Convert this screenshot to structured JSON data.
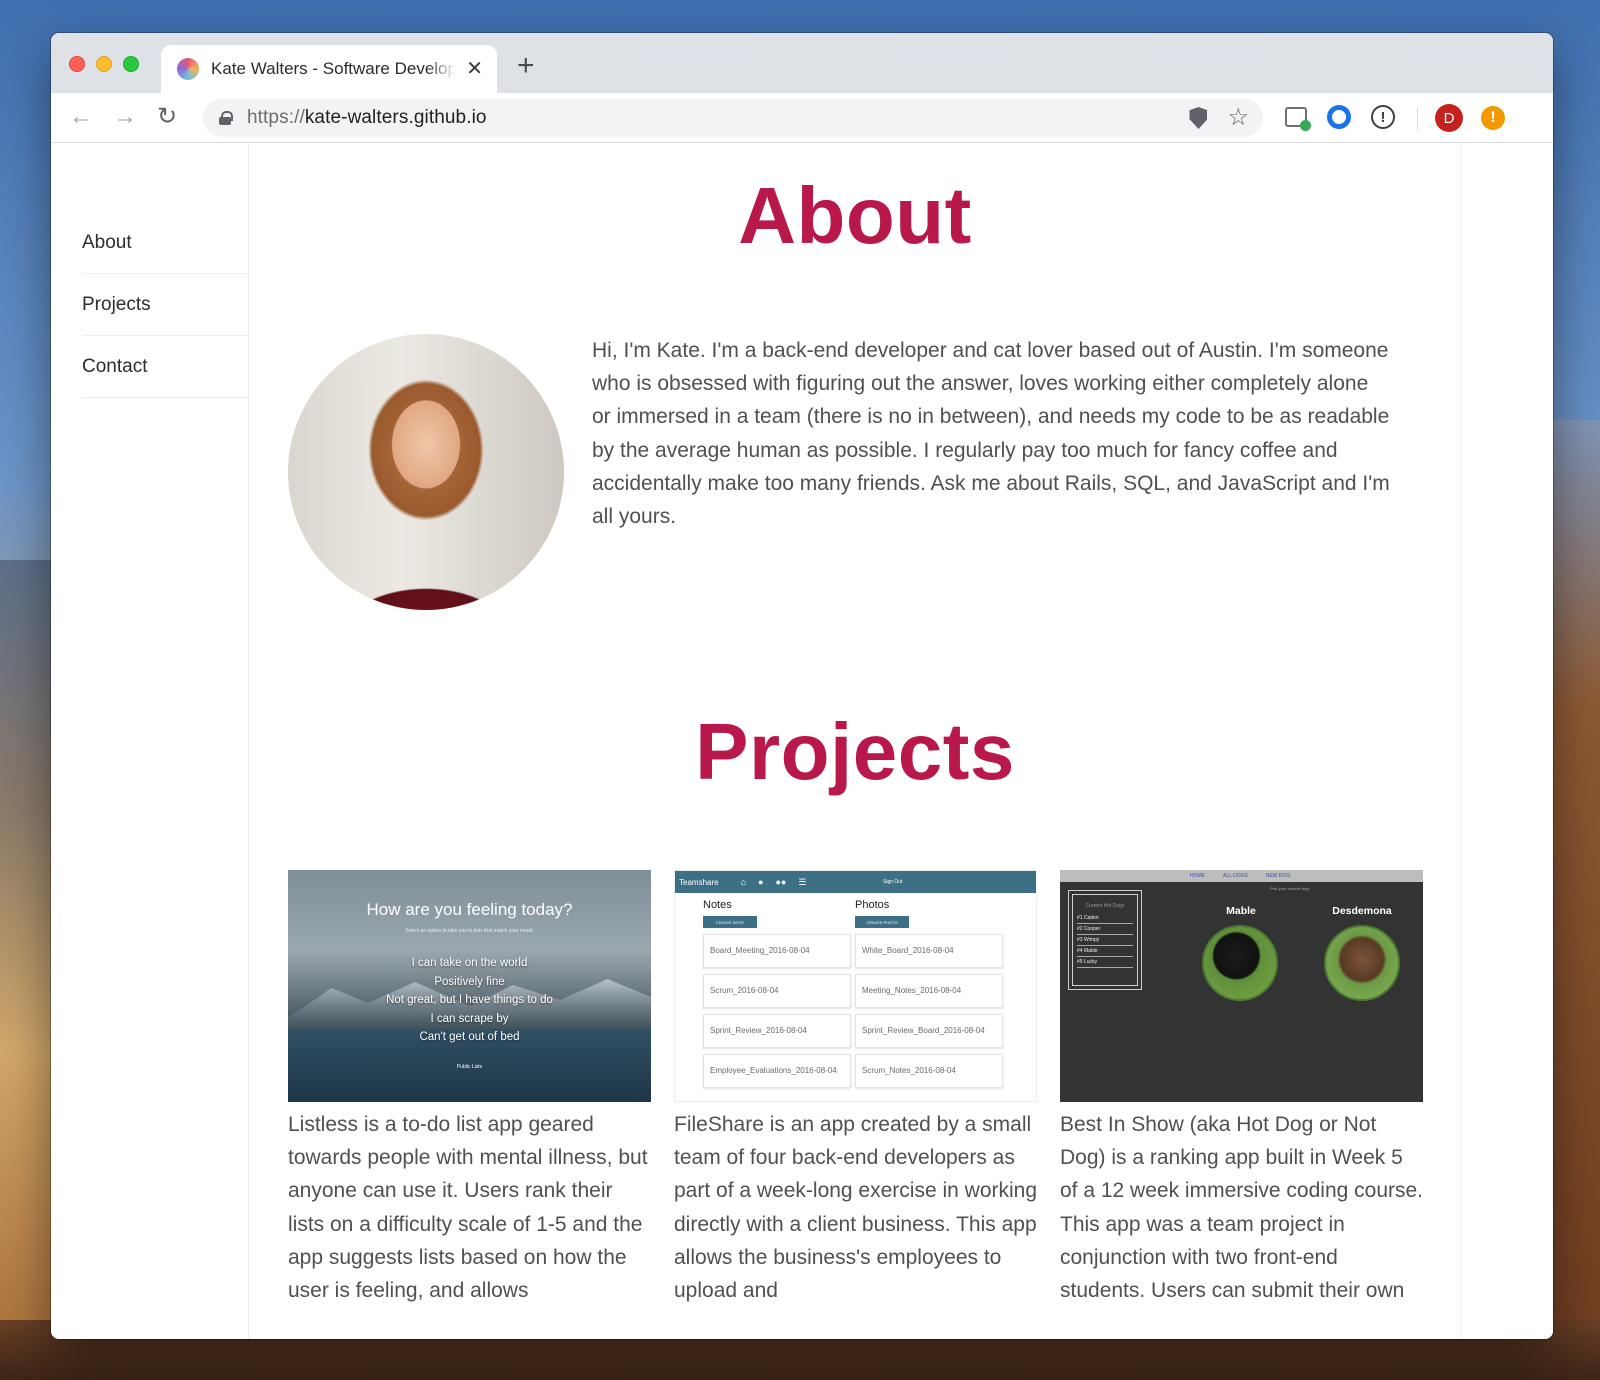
{
  "browser": {
    "tab_title": "Kate Walters - Software Developer",
    "new_tab_label": "+",
    "url_scheme": "https://",
    "url_host": "kate-walters.github.io",
    "profile_initial": "D",
    "info_glyph": "!",
    "alert_glyph": "!"
  },
  "sidebar": {
    "items": [
      {
        "label": "About"
      },
      {
        "label": "Projects"
      },
      {
        "label": "Contact"
      }
    ]
  },
  "about": {
    "title": "About",
    "bio": "Hi, I'm Kate. I'm a back-end developer and cat lover based out of Austin. I'm someone who is obsessed with figuring out the answer, loves working either completely alone or immersed in a team (there is no in between), and needs my code to be as readable by the average human as possible. I regularly pay too much for fancy coffee and accidentally make too many friends. Ask me about Rails, SQL, and JavaScript and I'm all yours."
  },
  "projects": {
    "title": "Projects",
    "items": [
      {
        "description": "Listless is a to-do list app geared towards people with mental illness, but anyone can use it. Users rank their lists on a difficulty scale of 1-5 and the app suggests lists based on how the user is feeling, and allows",
        "thumb": {
          "heading": "How are you feeling today?",
          "subheading": "Select an option to take you to lists that match your mood.",
          "options": [
            "I can take on the world",
            "Positively fine",
            "Not great, but I have things to do",
            "I can scrape by",
            "Can't get out of bed"
          ],
          "footer": "Public Lists"
        }
      },
      {
        "description": "FileShare is an app created by a small team of four back-end developers as part of a week-long exercise in working directly with a client business. This app allows the business's employees to upload and",
        "thumb": {
          "brand": "Teamshare",
          "signout": "Sign Out",
          "notes_heading": "Notes",
          "photos_heading": "Photos",
          "create_note": "CREATE NOTE",
          "create_photo": "CREATE PHOTO",
          "notes": [
            "Board_Meeting_2016-08-04",
            "Scrum_2016-08-04",
            "Sprint_Review_2016-08-04",
            "Employee_Evaluations_2016-08-04"
          ],
          "photos": [
            "White_Board_2016-08-04",
            "Meeting_Notes_2016-08-04",
            "Sprint_Review_Board_2016-08-04",
            "Scrum_Notes_2016-08-04"
          ]
        }
      },
      {
        "description": "Best In Show (aka Hot Dog or Not Dog) is a ranking app built in Week 5 of a 12 week immersive coding course. This app was a team project in conjunction with two front-end students. Users can submit their own",
        "thumb": {
          "nav": [
            "HOME",
            "ALL DOGS",
            "NEW DOG"
          ],
          "tagline": "Pick your favorite dog!",
          "list_title": "Current Hot Dogs",
          "ranking": [
            "#1 Caden",
            "#2 Cooper",
            "#3 Wimpy",
            "#4 Mable",
            "#5 Lucky"
          ],
          "dog1": "Mable",
          "dog2": "Desdemona"
        }
      }
    ]
  },
  "colors": {
    "accent": "#b8184a",
    "body_text": "#505050",
    "fileshare_bar": "#3d6f85"
  }
}
